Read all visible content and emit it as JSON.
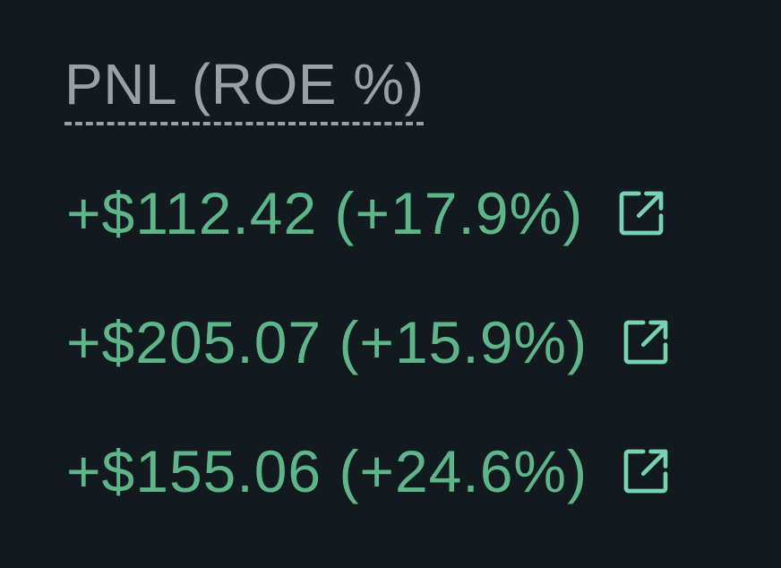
{
  "header": {
    "label": "PNL (ROE %)"
  },
  "colors": {
    "background": "#131a1f",
    "header_text": "#9aa1a6",
    "positive": "#5fb58a",
    "icon": "#78d2b4"
  },
  "rows": [
    {
      "pnl": "+$112.42 (+17.9%)",
      "icon": "external-link-icon"
    },
    {
      "pnl": "+$205.07 (+15.9%)",
      "icon": "external-link-icon"
    },
    {
      "pnl": "+$155.06 (+24.6%)",
      "icon": "external-link-icon"
    }
  ]
}
